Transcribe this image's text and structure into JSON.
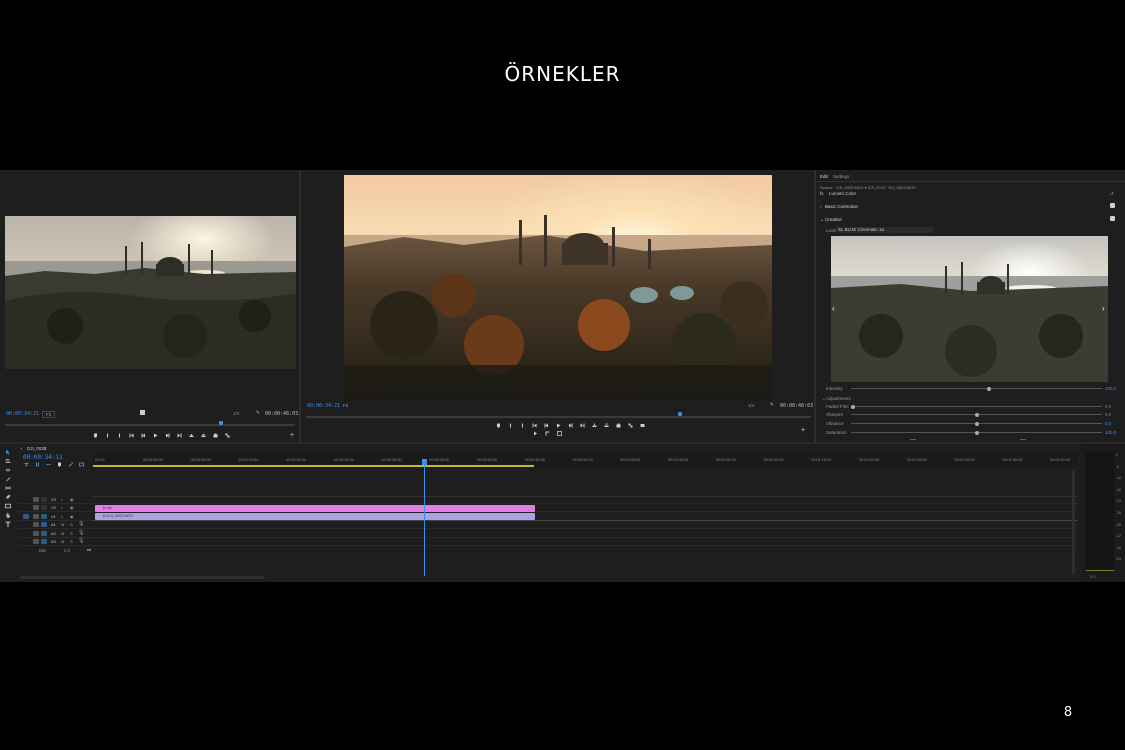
{
  "slide": {
    "title": "ÖRNEKLER",
    "page_number": "8"
  },
  "source_monitor": {
    "timecode_left": "00:00:34:21",
    "fit": "Fit",
    "resolution": "1/4",
    "timecode_right": "00:00:46:03"
  },
  "program_monitor": {
    "timecode_left": "00:00:34:21",
    "fit": "Fit",
    "resolution": "1/4",
    "timecode_right": "00:00:46:03",
    "playhead_fraction": 0.74
  },
  "lumetri": {
    "tabs": [
      "Edit",
      "Settings"
    ],
    "source_line": "Source · DJI_0023.MOV  ▾  DJI_0023 · DJI_0023.MOV",
    "effect_name": "Lumetri Color",
    "basic_correction": "Basic Correction",
    "creative": "Creative",
    "look_label": "Look",
    "look_value": "SL BLUE Cinematic 1a",
    "intensity": {
      "label": "Intensity",
      "value": "100,0",
      "fraction": 0.55
    },
    "adjustments": "Adjustments",
    "sliders": [
      {
        "label": "Faded Film",
        "value": "0,0",
        "fraction": 0.0
      },
      {
        "label": "Sharpen",
        "value": "0,0",
        "fraction": 0.5
      },
      {
        "label": "Vibrance",
        "value": "0,0",
        "fraction": 0.5
      },
      {
        "label": "Saturation",
        "value": "100,0",
        "fraction": 0.5
      }
    ]
  },
  "timeline": {
    "sequence_name": "DJI_0023",
    "timecode": "00:00:34:11",
    "ruler": [
      "00:00",
      "00:00:05:00",
      "00:00:10:00",
      "00:00:15:00",
      "00:00:20:00",
      "00:00:25:00",
      "00:00:30:00",
      "00:00:35:00",
      "00:00:40:00",
      "00:00:45:00",
      "00:00:50:00",
      "00:00:55:00",
      "00:01:00:00",
      "00:01:05:00",
      "00:01:10:00",
      "00:01:15:00",
      "00:01:20:00",
      "00:01:25:00",
      "00:01:30:00",
      "00:01:35:00",
      "00:01:40:00"
    ],
    "video_tracks": [
      "V3",
      "V2",
      "V1"
    ],
    "audio_tracks": [
      "A1",
      "A2",
      "A3"
    ],
    "mix_label": "Mix",
    "mix_value": "0,0",
    "clips": [
      {
        "label": "fx  nw",
        "color": "#e27ee3"
      },
      {
        "label": "fx  DJI_0023.MOV",
        "color": "#a9a3e6"
      }
    ],
    "playhead_fraction": 0.345
  },
  "meters": {
    "scale": [
      "0",
      "-6",
      "-12",
      "-18",
      "-24",
      "-30",
      "-36",
      "-42",
      "-48",
      "-54"
    ],
    "footer": "S  S"
  }
}
